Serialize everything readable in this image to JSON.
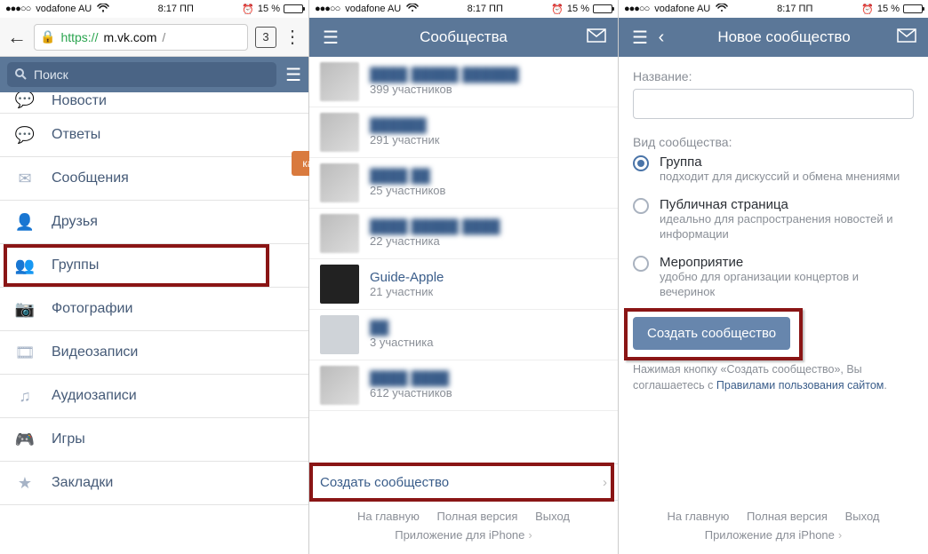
{
  "status": {
    "signal": "●●●○○",
    "carrier": "vodafone AU",
    "wifi": "⧙",
    "time": "8:17 ПП",
    "alarm": "⏰",
    "batt_pct": "15 %"
  },
  "pane1": {
    "address": {
      "proto": "https",
      "host": "m.vk.com",
      "slash": "/"
    },
    "tabcount": "3",
    "search_placeholder": "Поиск",
    "side_button": "кать",
    "menu": [
      {
        "icon": "💬",
        "label": "Новости",
        "cut": true
      },
      {
        "icon": "💬",
        "label": "Ответы"
      },
      {
        "icon": "✉",
        "label": "Сообщения"
      },
      {
        "icon": "👤",
        "label": "Друзья"
      },
      {
        "icon": "👥",
        "label": "Группы",
        "highlight": true
      },
      {
        "icon": "📷",
        "label": "Фотографии"
      },
      {
        "icon": "🎞",
        "label": "Видеозаписи"
      },
      {
        "icon": "♫",
        "label": "Аудиозаписи"
      },
      {
        "icon": "🎮",
        "label": "Игры"
      },
      {
        "icon": "★",
        "label": "Закладки"
      }
    ]
  },
  "pane2": {
    "title": "Сообщества",
    "items": [
      {
        "name": "████ █████ ██████",
        "sub": "399 участников"
      },
      {
        "name": "██████",
        "sub": "291 участник"
      },
      {
        "name": "████ ██",
        "sub": "25 участников"
      },
      {
        "name": "████ █████ ████",
        "sub": "22 участника"
      },
      {
        "name": "Guide-Apple",
        "sub": "21 участник",
        "clear": true
      },
      {
        "name": "██",
        "sub": "3 участника",
        "tiny": true
      },
      {
        "name": "████ ████",
        "sub": "612 участников"
      }
    ],
    "create": "Создать сообщество"
  },
  "pane3": {
    "title": "Новое сообщество",
    "name_label": "Название:",
    "type_label": "Вид сообщества:",
    "opts": [
      {
        "title": "Группа",
        "desc": "подходит для дискуссий и обмена мнениями",
        "on": true
      },
      {
        "title": "Публичная страница",
        "desc": "идеально для распространения новостей и информации"
      },
      {
        "title": "Мероприятие",
        "desc": "удобно для организации концертов и вечеринок"
      }
    ],
    "create_btn": "Создать сообщество",
    "agree_pre": "Нажимая кнопку «Создать сообщество», Вы соглашаетесь с ",
    "agree_link": "Правилами пользования сайтом",
    "agree_post": "."
  },
  "footer": {
    "home": "На главную",
    "full": "Полная версия",
    "exit": "Выход",
    "app": "Приложение для iPhone"
  }
}
